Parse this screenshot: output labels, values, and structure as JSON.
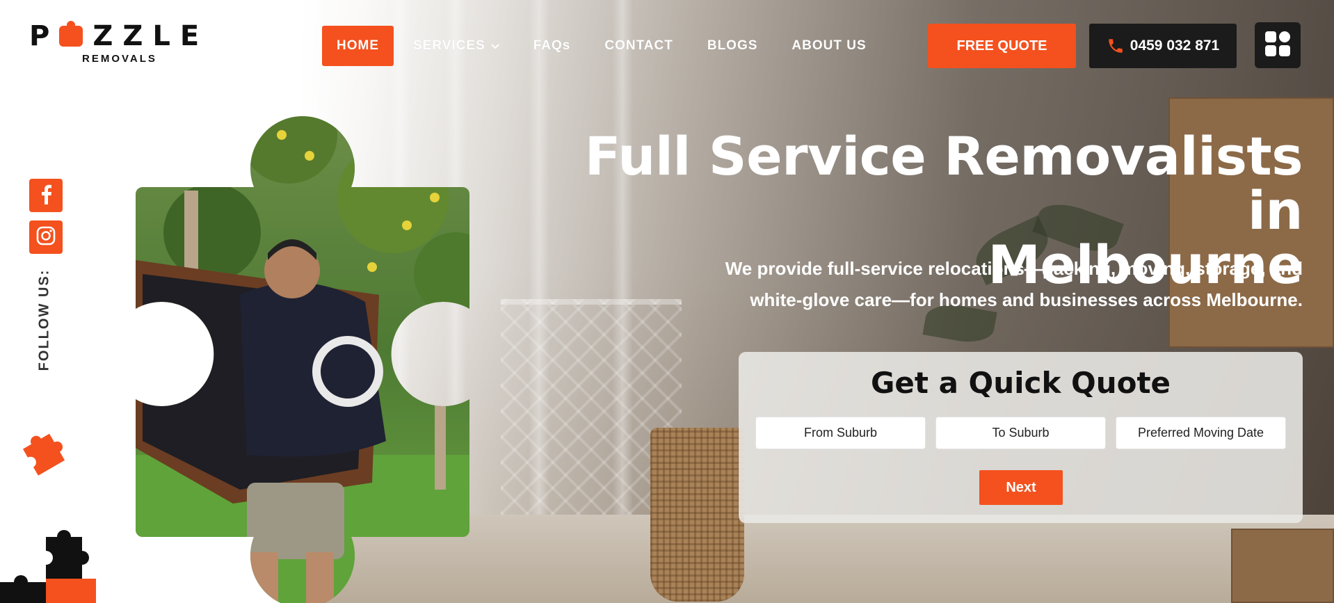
{
  "brand": {
    "logo_text": "PUZZLE",
    "logo_subtext": "REMOVALS",
    "accent_color": "#f4511e",
    "dark_color": "#1b1b1b"
  },
  "nav": {
    "items": [
      {
        "label": "HOME",
        "active": true
      },
      {
        "label": "SERVICES",
        "has_dropdown": true
      },
      {
        "label": "FAQs"
      },
      {
        "label": "CONTACT"
      },
      {
        "label": "BLOGS"
      },
      {
        "label": "ABOUT US"
      }
    ],
    "dropdown_icon": "chevron-down-icon"
  },
  "header_actions": {
    "quote_label": "FREE QUOTE",
    "phone_label": "0459 032 871",
    "phone_icon": "phone-icon",
    "menu_icon": "grid-menu-icon"
  },
  "social": {
    "follow_label": "FOLLOW US:",
    "links": [
      {
        "icon": "facebook-icon"
      },
      {
        "icon": "instagram-icon"
      }
    ]
  },
  "hero": {
    "title_line1": "Full Service Removalists in",
    "title_line2": "Melbourne",
    "subtitle_line1": "We provide full-service relocations—packing, moving, storage, and",
    "subtitle_line2": "white-glove care—for homes and businesses across Melbourne."
  },
  "quote_form": {
    "title": "Get a Quick Quote",
    "from_placeholder": "From Suburb",
    "to_placeholder": "To Suburb",
    "date_placeholder": "Preferred Moving Date",
    "next_label": "Next"
  }
}
